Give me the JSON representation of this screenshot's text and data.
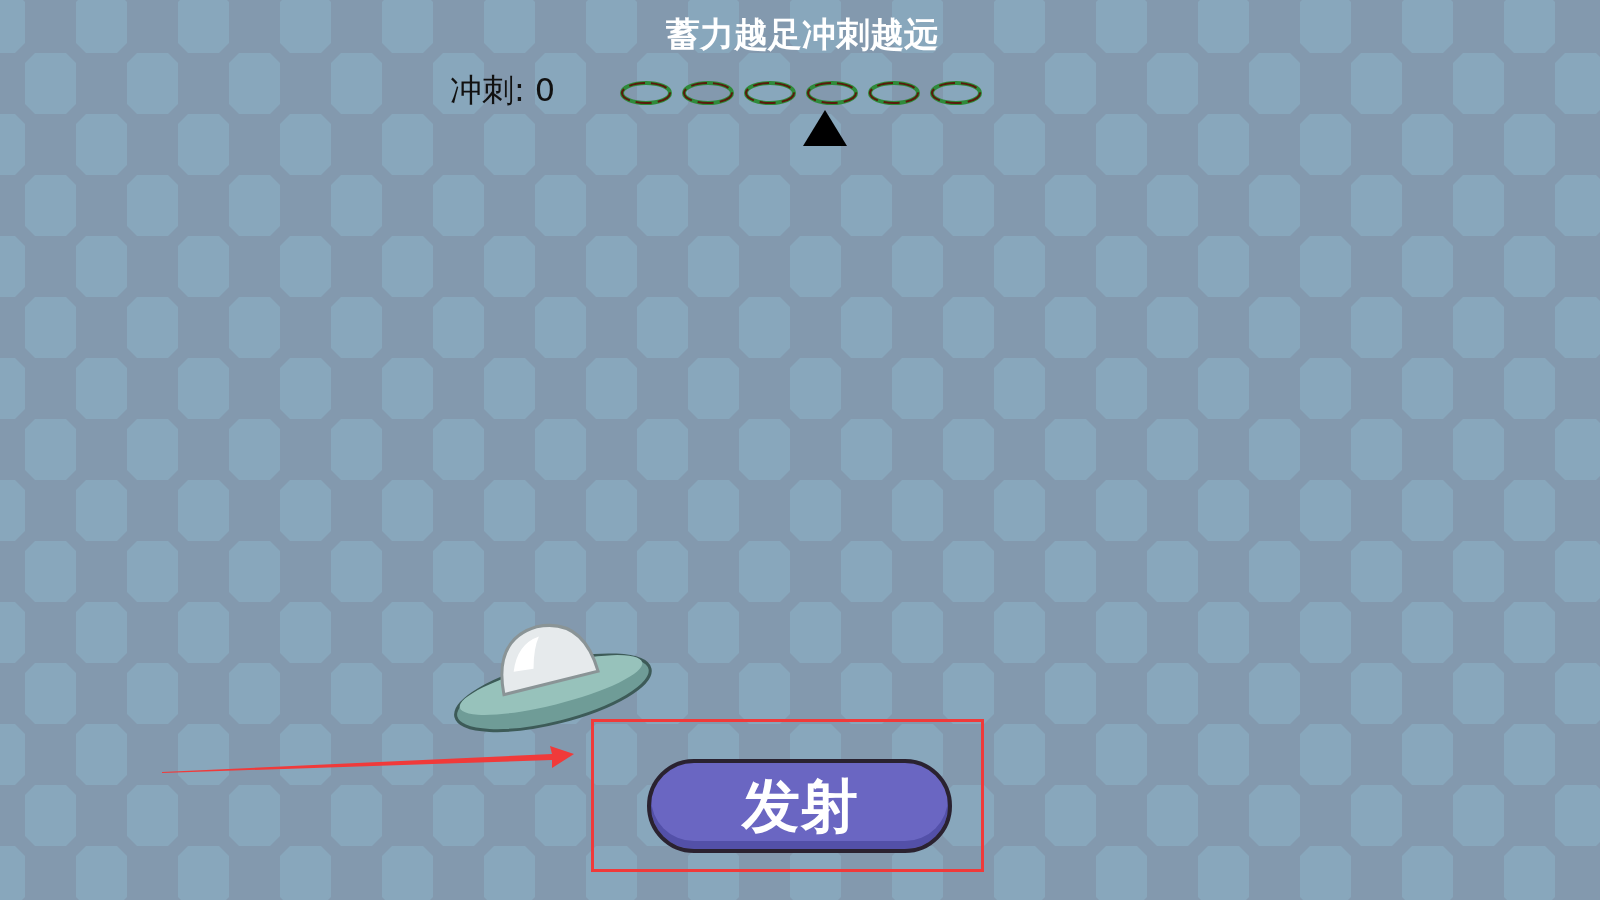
{
  "hint": "蓄力越足冲刺越远",
  "dash": {
    "label": "冲刺:",
    "value": "0"
  },
  "power_meter": {
    "rings": [
      {
        "kind": "ring"
      },
      {
        "kind": "ring"
      },
      {
        "kind": "ring"
      },
      {
        "kind": "ring"
      },
      {
        "kind": "ring"
      },
      {
        "kind": "ring"
      }
    ],
    "level": 0.55
  },
  "launch_button": {
    "label": "发射"
  }
}
